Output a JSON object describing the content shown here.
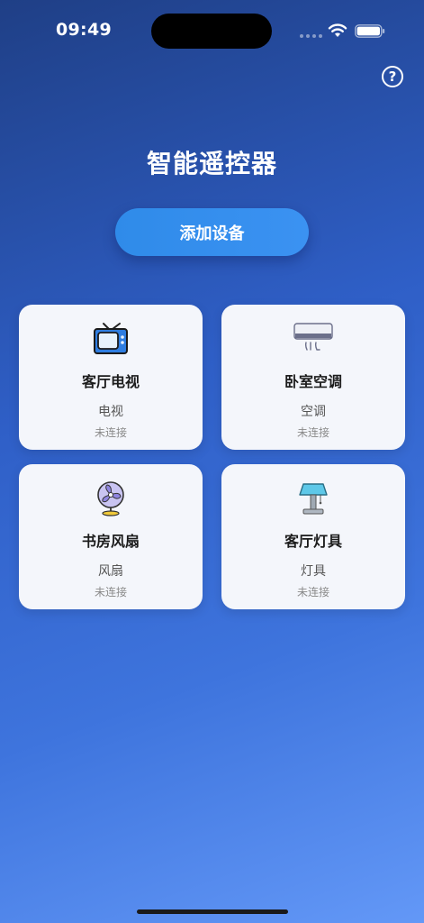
{
  "status_bar": {
    "time": "09:49"
  },
  "header": {
    "title": "智能遥控器",
    "help_label": "?"
  },
  "actions": {
    "add_device_label": "添加设备"
  },
  "devices": [
    {
      "name": "客厅电视",
      "type": "电视",
      "status": "未连接",
      "icon": "tv-icon"
    },
    {
      "name": "卧室空调",
      "type": "空调",
      "status": "未连接",
      "icon": "air-conditioner-icon"
    },
    {
      "name": "书房风扇",
      "type": "风扇",
      "status": "未连接",
      "icon": "fan-icon"
    },
    {
      "name": "客厅灯具",
      "type": "灯具",
      "status": "未连接",
      "icon": "lamp-icon"
    }
  ],
  "colors": {
    "button": "#2f8be9",
    "card": "#f4f6fb",
    "gradient_start": "#1f3f86",
    "gradient_end": "#6398f7"
  }
}
